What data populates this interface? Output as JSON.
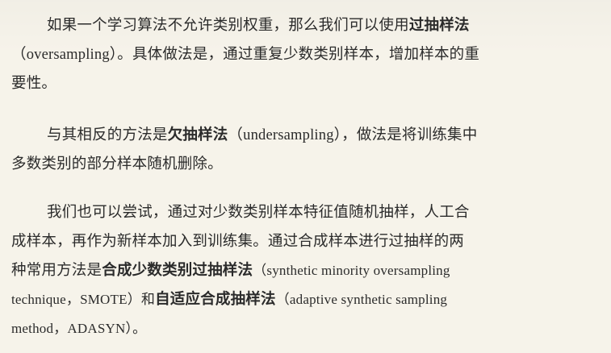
{
  "paragraphs": [
    {
      "lines": [
        [
          "如果一个学习算法不允许类别权重，那么我们可以使用",
          {
            "b": "过抽样法"
          }
        ],
        [
          "（oversampling）。具体做法是，通过重复少数类别样本，增加样本的重"
        ],
        [
          "要性。"
        ]
      ]
    },
    {
      "lines": [
        [
          "与其相反的方法是",
          {
            "b": "欠抽样法"
          },
          "（undersampling），做法是将训练集中"
        ],
        [
          "多数类别的部分样本随机删除。"
        ]
      ]
    },
    {
      "lines": [
        [
          "我们也可以尝试，通过对少数类别样本特征值随机抽样，人工合"
        ],
        [
          "成样本，再作为新样本加入到训练集。通过合成样本进行过抽样的两"
        ],
        [
          "种常用方法是",
          {
            "b": "合成少数类别过抽样法"
          },
          "（synthetic minority oversampling"
        ],
        [
          "technique，SMOTE）和",
          {
            "b": "自适应合成抽样法"
          },
          "（adaptive synthetic sampling"
        ],
        [
          "method，ADASYN）。"
        ]
      ]
    }
  ],
  "p1": {
    "l1a": "如果一个学习算法不允许类别权重，那么我们可以使用",
    "l1b": "过抽样法",
    "l2": "（oversampling）。具体做法是，通过重复少数类别样本，增加样本的重",
    "l3": "要性。"
  },
  "p2": {
    "l1a": "与其相反的方法是",
    "l1b": "欠抽样法",
    "l1c": "（undersampling），做法是将训练集中",
    "l2": "多数类别的部分样本随机删除。"
  },
  "p3": {
    "l1": "我们也可以尝试，通过对少数类别样本特征值随机抽样，人工合",
    "l2": "成样本，再作为新样本加入到训练集。通过合成样本进行过抽样的两",
    "l3a": "种常用方法是",
    "l3b": "合成少数类别过抽样法",
    "l3c": "（synthetic minority oversampling",
    "l4a": "technique，SMOTE）和",
    "l4b": "自适应合成抽样法",
    "l4c": "（adaptive synthetic sampling",
    "l5": "method，ADASYN）。"
  }
}
